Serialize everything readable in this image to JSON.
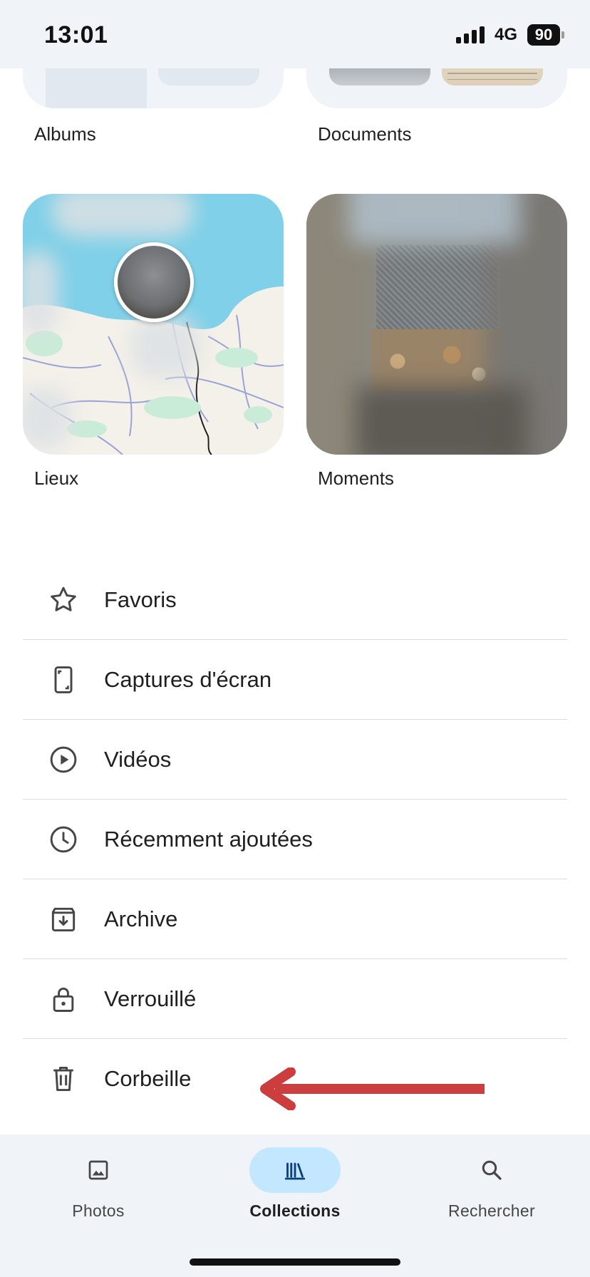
{
  "status_bar": {
    "time": "13:01",
    "network": "4G",
    "battery": "90"
  },
  "collections": {
    "albums_label": "Albums",
    "documents_label": "Documents",
    "places_label": "Lieux",
    "moments_label": "Moments"
  },
  "list": [
    {
      "label": "Favoris",
      "icon": "star-icon"
    },
    {
      "label": "Captures d'écran",
      "icon": "screenshot-icon"
    },
    {
      "label": "Vidéos",
      "icon": "play-circle-icon"
    },
    {
      "label": "Récemment ajoutées",
      "icon": "clock-icon"
    },
    {
      "label": "Archive",
      "icon": "archive-icon"
    },
    {
      "label": "Verrouillé",
      "icon": "lock-icon"
    },
    {
      "label": "Corbeille",
      "icon": "trash-icon"
    }
  ],
  "annotation": {
    "arrow_color": "#cc3d3d",
    "points_to": "Corbeille"
  },
  "bottom_nav": {
    "photos": "Photos",
    "collections": "Collections",
    "search": "Rechercher",
    "active": "collections"
  },
  "colors": {
    "accent": "#c2e7ff",
    "background_tint": "#f0f4f9",
    "map_sea": "#7fd0e8"
  }
}
